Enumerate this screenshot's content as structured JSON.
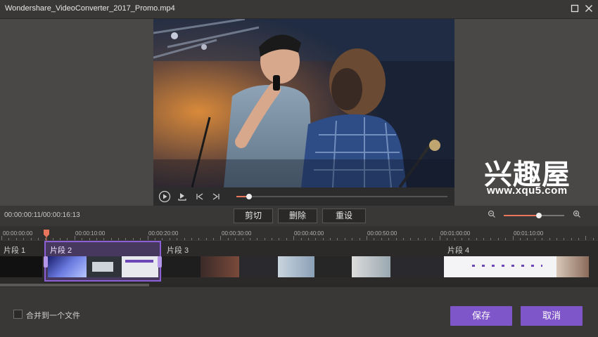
{
  "window": {
    "title": "Wondershare_VideoConverter_2017_Promo.mp4",
    "maximize_icon": "maximize-icon",
    "close_icon": "close-icon"
  },
  "watermark": {
    "main": "兴趣屋",
    "sub": "www.xqu5.com"
  },
  "player": {
    "play_icon": "play-icon",
    "snapshot_icon": "snapshot-icon",
    "prev_icon": "previous-frame-icon",
    "next_icon": "next-frame-icon",
    "progress": 0.06
  },
  "toolbar": {
    "time_readout": "00:00:00:11/00:00:16:13",
    "cut_label": "剪切",
    "delete_label": "删除",
    "reset_label": "重设",
    "zoom_level": 0.58
  },
  "ruler": {
    "labels": [
      "00:00:00:00",
      "00:00:10:00",
      "00:00:20:00",
      "00:00:30:00",
      "00:00:40:00",
      "00:00:50:00",
      "00:01:00:00",
      "00:01:10:00"
    ]
  },
  "segments": [
    {
      "label": "片段 1"
    },
    {
      "label": "片段 2"
    },
    {
      "label": "片段 3"
    },
    {
      "label": "片段 4"
    }
  ],
  "footer": {
    "merge_label": "合并到一个文件",
    "save_label": "保存",
    "cancel_label": "取消"
  },
  "colors": {
    "accent": "#7f56c9",
    "progress": "#e8765c"
  }
}
